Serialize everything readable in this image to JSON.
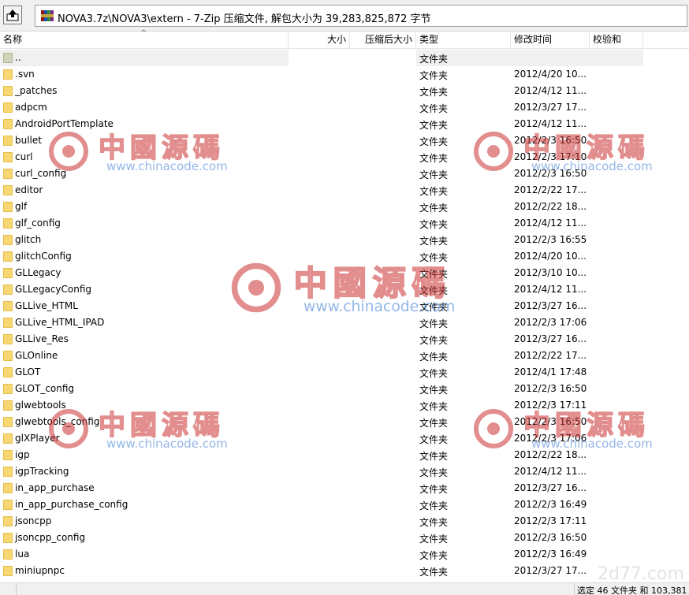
{
  "address": {
    "path": "NOVA3.7z\\NOVA3\\extern - 7-Zip 压缩文件, 解包大小为 39,283,825,872 字节"
  },
  "columns": {
    "name": "名称",
    "size": "大小",
    "packed": "压缩后大小",
    "type": "类型",
    "modified": "修改时间",
    "checksum": "校验和"
  },
  "rows": [
    {
      "name": "..",
      "type": "文件夹",
      "modified": ""
    },
    {
      "name": ".svn",
      "type": "文件夹",
      "modified": "2012/4/20 10..."
    },
    {
      "name": "_patches",
      "type": "文件夹",
      "modified": "2012/4/12 11..."
    },
    {
      "name": "adpcm",
      "type": "文件夹",
      "modified": "2012/3/27 17..."
    },
    {
      "name": "AndroidPortTemplate",
      "type": "文件夹",
      "modified": "2012/4/12 11..."
    },
    {
      "name": "bullet",
      "type": "文件夹",
      "modified": "2012/2/3 16:50"
    },
    {
      "name": "curl",
      "type": "文件夹",
      "modified": "2012/2/3 17:10"
    },
    {
      "name": "curl_config",
      "type": "文件夹",
      "modified": "2012/2/3 16:50"
    },
    {
      "name": "editor",
      "type": "文件夹",
      "modified": "2012/2/22 17..."
    },
    {
      "name": "glf",
      "type": "文件夹",
      "modified": "2012/2/22 18..."
    },
    {
      "name": "glf_config",
      "type": "文件夹",
      "modified": "2012/4/12 11..."
    },
    {
      "name": "glitch",
      "type": "文件夹",
      "modified": "2012/2/3 16:55"
    },
    {
      "name": "glitchConfig",
      "type": "文件夹",
      "modified": "2012/4/20 10..."
    },
    {
      "name": "GLLegacy",
      "type": "文件夹",
      "modified": "2012/3/10 10..."
    },
    {
      "name": "GLLegacyConfig",
      "type": "文件夹",
      "modified": "2012/4/12 11..."
    },
    {
      "name": "GLLive_HTML",
      "type": "文件夹",
      "modified": "2012/3/27 16..."
    },
    {
      "name": "GLLive_HTML_IPAD",
      "type": "文件夹",
      "modified": "2012/2/3 17:06"
    },
    {
      "name": "GLLive_Res",
      "type": "文件夹",
      "modified": "2012/3/27 16..."
    },
    {
      "name": "GLOnline",
      "type": "文件夹",
      "modified": "2012/2/22 17..."
    },
    {
      "name": "GLOT",
      "type": "文件夹",
      "modified": "2012/4/1 17:48"
    },
    {
      "name": "GLOT_config",
      "type": "文件夹",
      "modified": "2012/2/3 16:50"
    },
    {
      "name": "glwebtools",
      "type": "文件夹",
      "modified": "2012/2/3 17:11"
    },
    {
      "name": "glwebtools_config",
      "type": "文件夹",
      "modified": "2012/2/3 16:50"
    },
    {
      "name": "glXPlayer",
      "type": "文件夹",
      "modified": "2012/2/3 17:06"
    },
    {
      "name": "igp",
      "type": "文件夹",
      "modified": "2012/2/22 18..."
    },
    {
      "name": "igpTracking",
      "type": "文件夹",
      "modified": "2012/4/12 11..."
    },
    {
      "name": "in_app_purchase",
      "type": "文件夹",
      "modified": "2012/3/27 16..."
    },
    {
      "name": "in_app_purchase_config",
      "type": "文件夹",
      "modified": "2012/2/3 16:49"
    },
    {
      "name": "jsoncpp",
      "type": "文件夹",
      "modified": "2012/2/3 17:11"
    },
    {
      "name": "jsoncpp_config",
      "type": "文件夹",
      "modified": "2012/2/3 16:50"
    },
    {
      "name": "lua",
      "type": "文件夹",
      "modified": "2012/2/3 16:49"
    },
    {
      "name": "miniupnpc",
      "type": "文件夹",
      "modified": "2012/3/27 17..."
    }
  ],
  "status": {
    "text": "选定 46 文件夹 和 103,381"
  },
  "watermark": {
    "cn": "中國源碼",
    "url": "www.chinacode.com",
    "corner": "2d77.com"
  },
  "icons": {
    "up": "up-folder-icon",
    "archive": "archive-icon",
    "folder": "folder-icon"
  },
  "colors": {
    "folder": "#f7d774",
    "watermark_red": "#cc3333",
    "watermark_blue": "#3a7bd5"
  }
}
